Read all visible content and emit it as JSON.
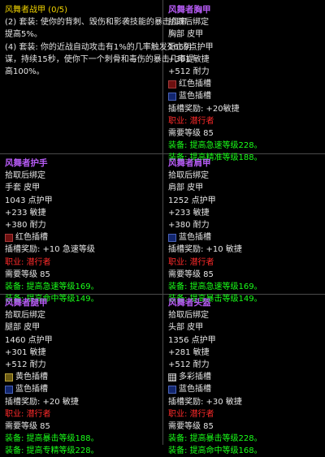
{
  "set_bonus_panel": {
    "title": "风舞者战甲 (0/5)",
    "bonus_lines": [
      "(2) 套装: 使你的背刺、毁伤和影袭技能的暴击几率",
      "提高5%。",
      "(4) 套装: 你的近战自动攻击有1%的几率触发死亡阴",
      "谋，持续15秒，使你下一个刺骨和毒伤的暴击几率提",
      "高100%。"
    ]
  },
  "items": {
    "chest": {
      "name": "风舞者胸甲",
      "bind": "拾取后绑定",
      "slot": "胸部 皮甲",
      "armor": "1669点护甲",
      "stat1": "+301 敏捷",
      "stat2": "+512 耐力",
      "socket1": "红色插槽",
      "socket2": "蓝色插槽",
      "socket_bonus": "插槽奖励: +20敏捷",
      "class": "职业: 潜行者",
      "level": "需要等级 85",
      "equip1": "装备: 提高急速等级228。",
      "equip2": "装备: 提高精准等级188。"
    },
    "hands": {
      "name": "风舞者护手",
      "bind": "拾取后绑定",
      "slot": "手套 皮甲",
      "armor": "1043 点护甲",
      "stat1": "+233 敏捷",
      "stat2": "+380 耐力",
      "socket1": "红色插槽",
      "socket_bonus": "插槽奖励: +10 急速等级",
      "class": "职业: 潜行者",
      "level": "需要等级 85",
      "equip1": "装备: 提高急速等级169。",
      "equip2": "装备: 提高命中等级149。"
    },
    "shoulder": {
      "name": "风舞者肩甲",
      "bind": "拾取后绑定",
      "slot": "肩部 皮甲",
      "armor": "1252 点护甲",
      "stat1": "+233 敏捷",
      "stat2": "+380 耐力",
      "socket1": "蓝色插槽",
      "socket_bonus": "插槽奖励: +10 敏捷",
      "class": "职业: 潜行者",
      "level": "需要等级 85",
      "equip1": "装备: 提高急速等级169。",
      "equip2": "装备: 提高暴击等级149。"
    },
    "legs": {
      "name": "风舞者腿甲",
      "bind": "拾取后绑定",
      "slot": "腿部 皮甲",
      "armor": "1460 点护甲",
      "stat1": "+301 敏捷",
      "stat2": "+512 耐力",
      "socket1": "黄色插槽",
      "socket2": "蓝色插槽",
      "socket_bonus": "插槽奖励: +20 敏捷",
      "class": "职业: 潜行者",
      "level": "需要等级 85",
      "equip1": "装备: 提高暴击等级188。",
      "equip2": "装备: 提高专精等级228。"
    },
    "head": {
      "name": "风舞者头盔",
      "bind": "拾取后绑定",
      "slot": "头部 皮甲",
      "armor": "1356 点护甲",
      "stat1": "+281 敏捷",
      "stat2": "+512 耐力",
      "socket1": "多彩插槽",
      "socket2": "蓝色插槽",
      "socket_bonus": "插槽奖励: +30 敏捷",
      "class": "职业: 潜行者",
      "level": "需要等级 85",
      "equip1": "装备: 提高暴击等级228。",
      "equip2": "装备: 提高命中等级168。"
    }
  },
  "colors": {
    "item_name": "#b85cf7",
    "set_title": "#f2d400",
    "class_req": "#ff2a2a",
    "equip_effect": "#19ff19",
    "grid": "#4a4a4a"
  }
}
